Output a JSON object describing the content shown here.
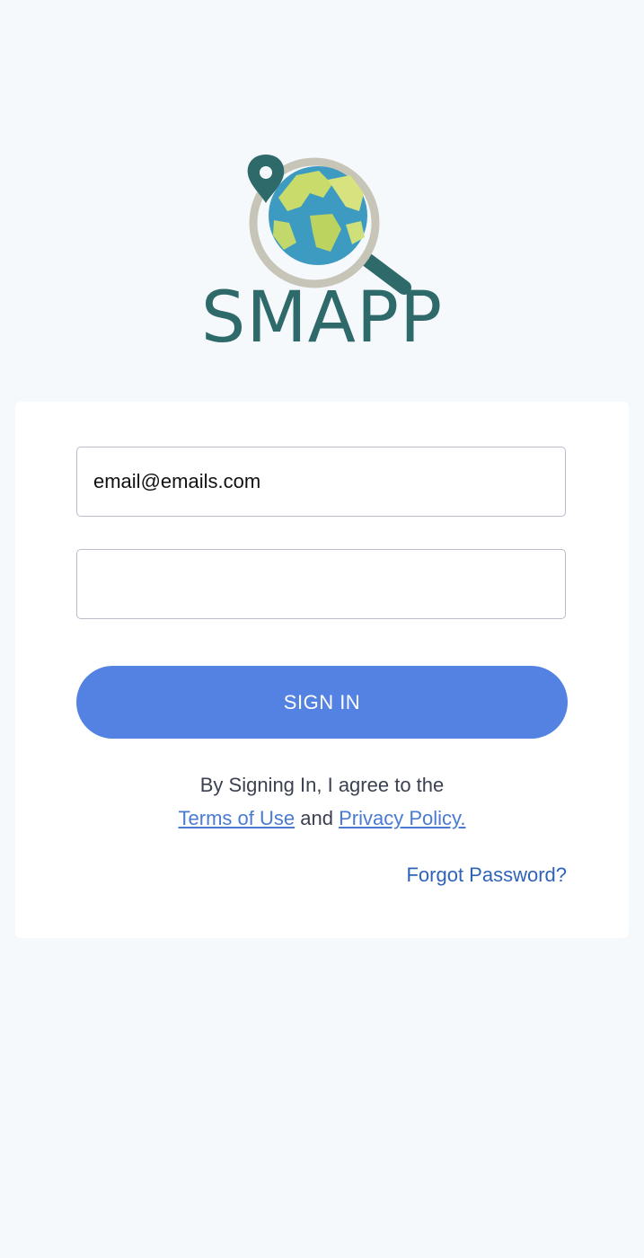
{
  "brand": {
    "name": "SMAPP",
    "color": "#2f6a6b"
  },
  "login": {
    "email_value": "email@emails.com",
    "password_value": "",
    "sign_in_label": "SIGN IN",
    "agree_prefix": "By Signing In, I agree to the",
    "terms_label": "Terms of Use",
    "and_text": "and",
    "privacy_label": "Privacy Policy.",
    "forgot_label": "Forgot Password?"
  },
  "colors": {
    "background": "#f6f9fb",
    "accent": "#5382e2",
    "link": "#4a7bd0"
  }
}
